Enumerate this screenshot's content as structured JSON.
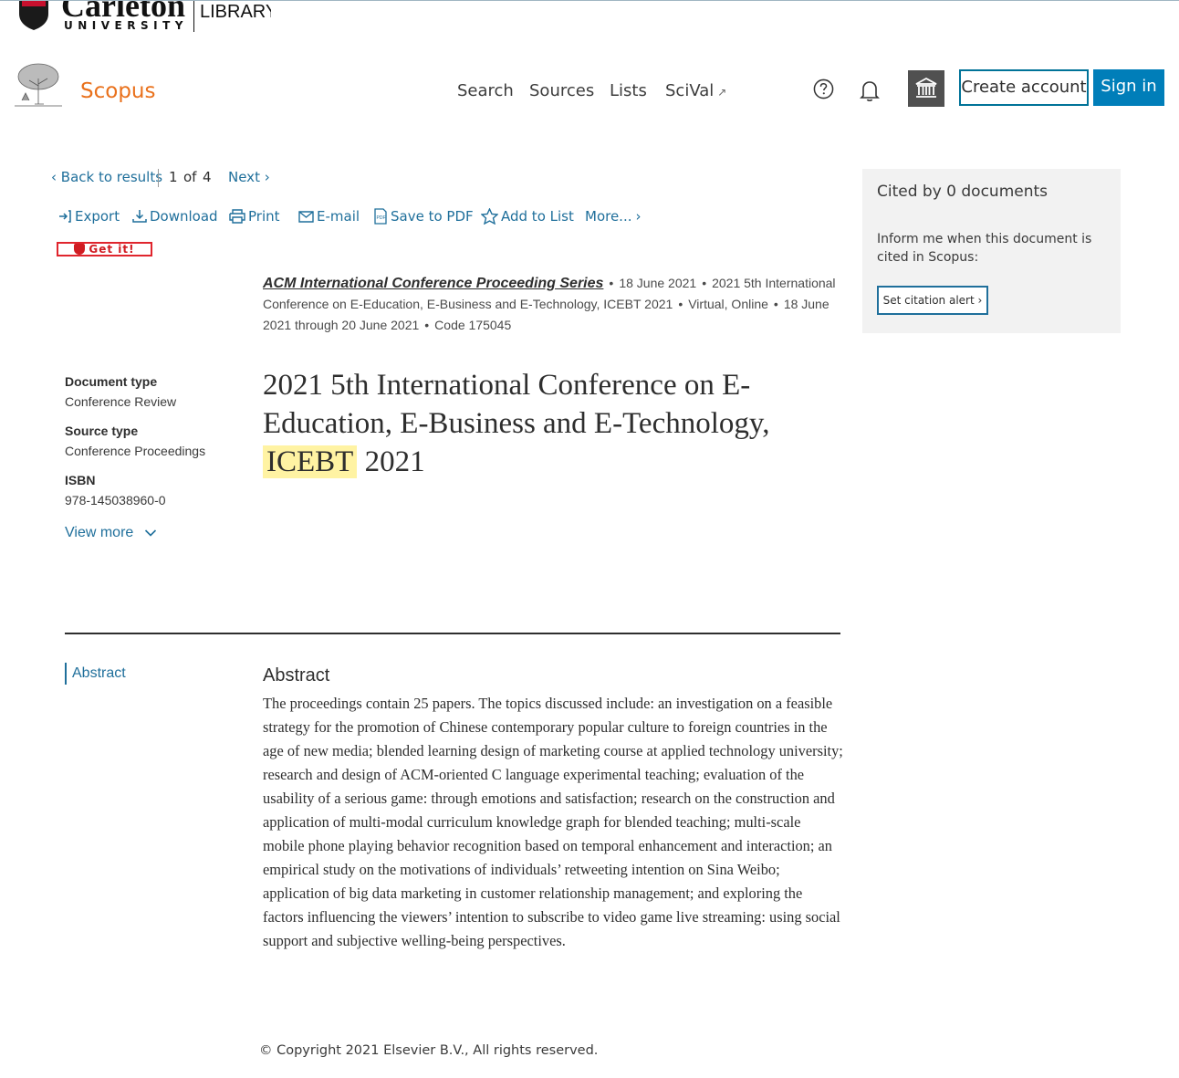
{
  "institution": {
    "name": "Carleton",
    "subtitle": "UNIVERSITY",
    "library": "LIBRARY"
  },
  "header": {
    "brand": "Scopus",
    "nav": [
      "Search",
      "Sources",
      "Lists",
      "SciVal"
    ],
    "create_account": "Create account",
    "sign_in": "Sign in"
  },
  "result_nav": {
    "back": "Back to results",
    "current": "1",
    "of": "of",
    "total": "4",
    "next": "Next"
  },
  "toolbar": {
    "export": "Export",
    "download": "Download",
    "print": "Print",
    "email": "E-mail",
    "save_pdf": "Save to PDF",
    "add_list": "Add to List",
    "more": "More..."
  },
  "getit": "Get it!",
  "source": {
    "series": "ACM International Conference Proceeding Series",
    "date": "18 June 2021",
    "conference": "2021 5th International Conference on E-Education, E-Business and E-Technology, ICEBT 2021",
    "location": "Virtual, Online",
    "conf_dates": "18 June 2021 through 20 June 2021",
    "code": "Code 175045"
  },
  "meta": {
    "doc_type_label": "Document type",
    "doc_type": "Conference Review",
    "source_type_label": "Source type",
    "source_type": "Conference Proceedings",
    "isbn_label": "ISBN",
    "isbn": "978-145038960-0",
    "view_more": "View more"
  },
  "title": {
    "before": "2021 5th International Conference on E-Education, E-Business and E-Technology, ",
    "highlight": "ICEBT",
    "after": " 2021"
  },
  "abstract": {
    "nav_label": "Abstract",
    "heading": "Abstract",
    "text": "The proceedings contain 25 papers. The topics discussed include: an investigation on a feasible strategy for the promotion of Chinese contemporary popular culture to foreign countries in the age of new media; blended learning design of marketing course at applied technology university; research and design of ACM-oriented C language experimental teaching; evaluation of the usability of a serious game: through emotions and satisfaction; research on the construction and application of multi-modal curriculum knowledge graph for blended teaching; multi-scale mobile phone playing behavior recognition based on temporal enhancement and interaction; an empirical study on the motivations of individuals’ retweeting intention on Sina Weibo; application of big data marketing in customer relationship management; and exploring the factors influencing the viewers’ intention to subscribe to video game live streaming: using social support and subjective welling-being perspectives."
  },
  "copyright": "Copyright 2021 Elsevier B.V., All rights reserved.",
  "cited": {
    "title": "Cited by 0 documents",
    "inform": "Inform me when this document is cited in Scopus:",
    "alert_button": "Set citation alert"
  },
  "colors": {
    "brand_orange": "#e9711c",
    "link_blue": "#1f6f9b",
    "signin_blue": "#007eb9",
    "highlight_yellow": "#fff3a3"
  }
}
